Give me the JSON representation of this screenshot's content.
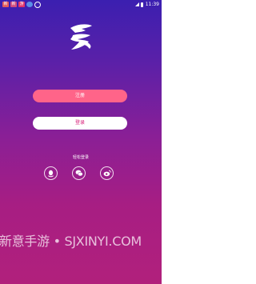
{
  "status_bar": {
    "notifications": [
      "新",
      "新",
      "游",
      "",
      ""
    ],
    "time": "11:39"
  },
  "logo": {
    "icon": "brand-swirl-logo",
    "color": "#ffffff"
  },
  "buttons": {
    "register_label": "注册",
    "login_label": "登录"
  },
  "quick_login": {
    "label": "轻松登录",
    "providers": [
      {
        "name": "qq",
        "icon": "qq-icon"
      },
      {
        "name": "wechat",
        "icon": "wechat-icon"
      },
      {
        "name": "weibo",
        "icon": "weibo-icon"
      }
    ]
  },
  "watermark": "新意手游 • SJXINYI.COM",
  "colors": {
    "background_top": "#3b1fb0",
    "background_bottom": "#b1207c",
    "register_button": "#ff6489",
    "login_button": "#ffffff",
    "login_text": "#d8207a"
  }
}
